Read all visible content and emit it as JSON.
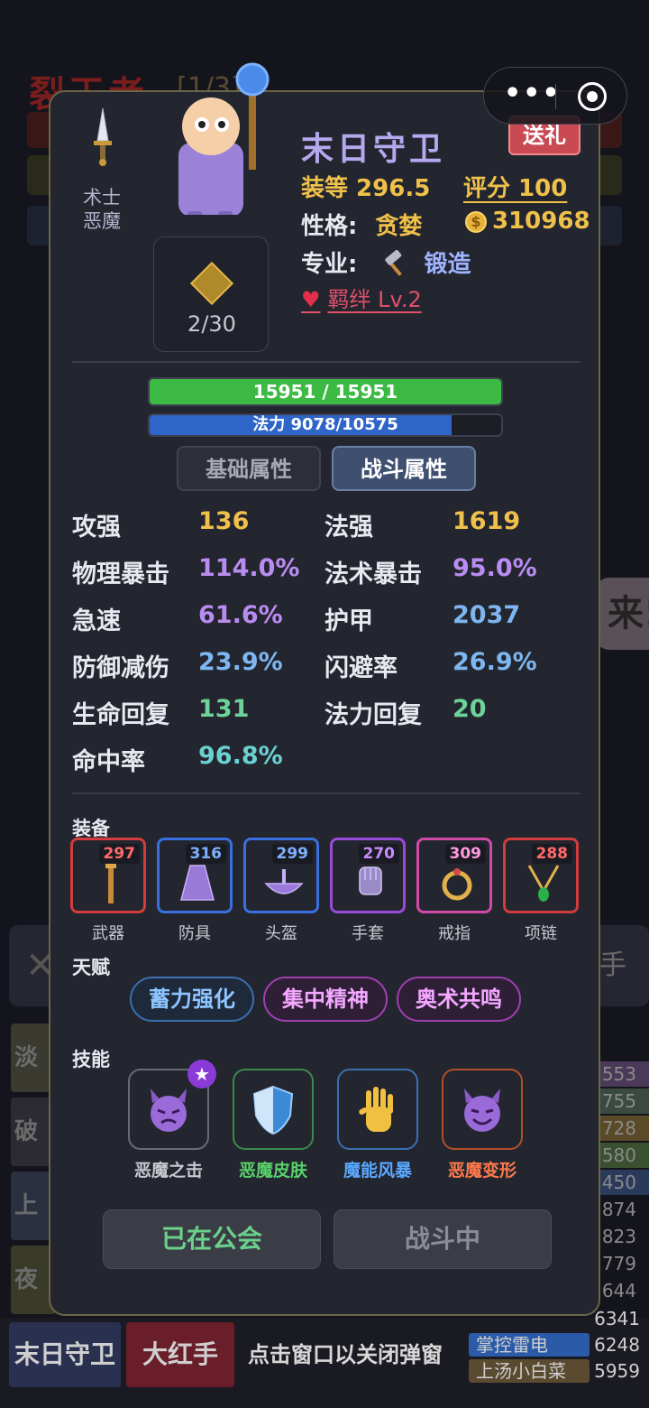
{
  "background": {
    "title": "裂王者",
    "title_count": "[1/3]",
    "capsule_more": "•••",
    "left_bottom_tab": "末日守卫",
    "tab2": "大红手",
    "tab3": "点击窗口以关闭弹窗",
    "bubble_text": "来!",
    "side_btn_left": "✕",
    "side_btn_right": "手",
    "list_left": [
      "淡",
      "破",
      "上",
      "夜"
    ],
    "right_list": [
      {
        "name": "",
        "value": "553"
      },
      {
        "name": "",
        "value": "755"
      },
      {
        "name": "",
        "value": "728"
      },
      {
        "name": "",
        "value": "580"
      },
      {
        "name": "",
        "value": "450"
      },
      {
        "name": "",
        "value": "874"
      },
      {
        "name": "",
        "value": "823"
      },
      {
        "name": "",
        "value": "779"
      },
      {
        "name": "",
        "value": "644"
      },
      {
        "name": "",
        "value": "6341"
      },
      {
        "name": "掌控雷电",
        "value": "6248"
      },
      {
        "name": "上汤小白菜",
        "value": "5959"
      }
    ]
  },
  "character": {
    "class_name": "术士",
    "race": "恶魔",
    "name": "末日守卫",
    "gift_button": "送礼",
    "gear_label": "装等 296.5",
    "score_label": "评分 100",
    "personality_label": "性格:",
    "personality_value": "贪婪",
    "coins": "310968",
    "profession_label": "专业:",
    "profession_value": "锻造",
    "bond": "羁绊 Lv.2",
    "token_count": "2/30"
  },
  "bars": {
    "hp_text": "15951 / 15951",
    "hp_fraction": 1.0,
    "mp_text": "法力 9078/10575",
    "mp_fraction": 0.8585
  },
  "tabs": {
    "basic": "基础属性",
    "combat": "战斗属性"
  },
  "stats": [
    {
      "label": "攻强",
      "value": "136",
      "color": "gold"
    },
    {
      "label": "法强",
      "value": "1619",
      "color": "gold"
    },
    {
      "label": "物理暴击",
      "value": "114.0%",
      "color": "purple"
    },
    {
      "label": "法术暴击",
      "value": "95.0%",
      "color": "purple"
    },
    {
      "label": "急速",
      "value": "61.6%",
      "color": "purple"
    },
    {
      "label": "护甲",
      "value": "2037",
      "color": "blue"
    },
    {
      "label": "防御减伤",
      "value": "23.9%",
      "color": "blue"
    },
    {
      "label": "闪避率",
      "value": "26.9%",
      "color": "blue"
    },
    {
      "label": "生命回复",
      "value": "131",
      "color": "green"
    },
    {
      "label": "法力回复",
      "value": "20",
      "color": "green"
    },
    {
      "label": "命中率",
      "value": "96.8%",
      "color": "teal"
    }
  ],
  "equipment": {
    "title": "装备",
    "items": [
      {
        "name": "武器",
        "level": "297",
        "border": "#d23c3c",
        "level_color": "#ff6a6a"
      },
      {
        "name": "防具",
        "level": "316",
        "border": "#3a6fe0",
        "level_color": "#7fb0ff"
      },
      {
        "name": "头盔",
        "level": "299",
        "border": "#3a6fe0",
        "level_color": "#7fb0ff"
      },
      {
        "name": "手套",
        "level": "270",
        "border": "#9a4ad8",
        "level_color": "#c58cff"
      },
      {
        "name": "戒指",
        "level": "309",
        "border": "#d04aa8",
        "level_color": "#ff9adf"
      },
      {
        "name": "项链",
        "level": "288",
        "border": "#d23c3c",
        "level_color": "#ff6a6a"
      }
    ]
  },
  "talents": {
    "title": "天赋",
    "items": [
      "蓄力强化",
      "集中精神",
      "奥术共鸣"
    ]
  },
  "skills": {
    "title": "技能",
    "items": [
      {
        "name": "恶魔之击",
        "icon": "devil-face-icon"
      },
      {
        "name": "恶魔皮肤",
        "icon": "shield-icon"
      },
      {
        "name": "魔能风暴",
        "icon": "hand-icon"
      },
      {
        "name": "恶魔变形",
        "icon": "devil-smile-icon"
      }
    ]
  },
  "buttons": {
    "guild": "已在公会",
    "battle": "战斗中"
  }
}
